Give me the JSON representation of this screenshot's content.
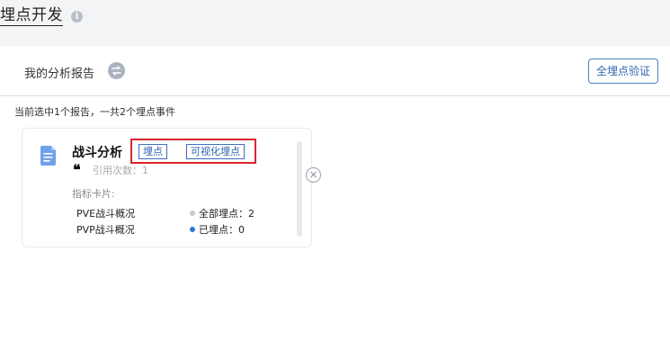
{
  "header": {
    "title": "埋点开发",
    "info_icon": "i"
  },
  "panel": {
    "title": "我的分析报告",
    "verify_button": "全埋点验证",
    "summary": "当前选中1个报告，一共2个埋点事件"
  },
  "card": {
    "title": "战斗分析",
    "tags": [
      "埋点",
      "可视化埋点"
    ],
    "citation_label": "引用次数：",
    "citation_count": "1",
    "metrics_header": "指标卡片:",
    "metrics": [
      "PVE战斗概况",
      "PVP战斗概况"
    ],
    "stats": [
      {
        "label": "全部埋点：",
        "value": "2",
        "color": "#c5cad3"
      },
      {
        "label": "已埋点：",
        "value": "0",
        "color": "#2a78d6"
      }
    ],
    "close_glyph": "×",
    "quote_glyph": "❝"
  },
  "colors": {
    "accent": "#2f67b2",
    "highlight_box": "#d9262c"
  }
}
